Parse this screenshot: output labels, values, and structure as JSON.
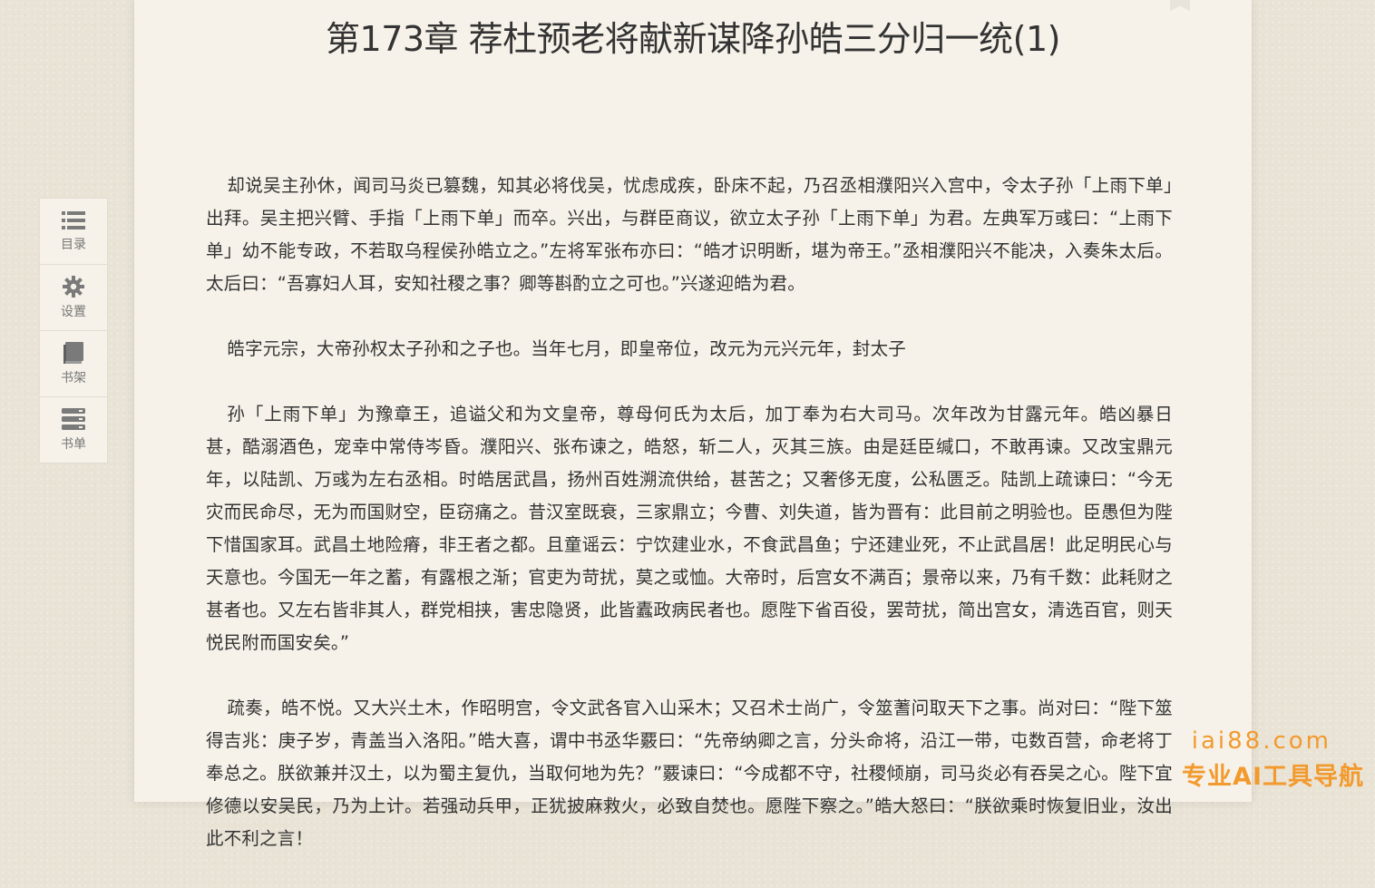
{
  "chapter": {
    "title": "第173章 荐杜预老将献新谋降孙皓三分归一统(1)",
    "paragraphs": [
      "却说吴主孙休，闻司马炎已篡魏，知其必将伐吴，忧虑成疾，卧床不起，乃召丞相濮阳兴入宫中，令太子孙「上雨下单」出拜。吴主把兴臂、手指「上雨下单」而卒。兴出，与群臣商议，欲立太子孙「上雨下单」为君。左典军万彧曰：“上雨下单」幼不能专政，不若取乌程侯孙皓立之。”左将军张布亦曰：“皓才识明断，堪为帝王。”丞相濮阳兴不能决，入奏朱太后。太后曰：“吾寡妇人耳，安知社稷之事？卿等斟酌立之可也。”兴遂迎皓为君。",
      "皓字元宗，大帝孙权太子孙和之子也。当年七月，即皇帝位，改元为元兴元年，封太子",
      "孙「上雨下单」为豫章王，追谥父和为文皇帝，尊母何氏为太后，加丁奉为右大司马。次年改为甘露元年。皓凶暴日甚，酷溺酒色，宠幸中常侍岑昏。濮阳兴、张布谏之，皓怒，斩二人，灭其三族。由是廷臣缄口，不敢再谏。又改宝鼎元年，以陆凯、万彧为左右丞相。时皓居武昌，扬州百姓溯流供给，甚苦之；又奢侈无度，公私匮乏。陆凯上疏谏曰：“今无灾而民命尽，无为而国财空，臣窃痛之。昔汉室既衰，三家鼎立；今曹、刘失道，皆为晋有：此目前之明验也。臣愚但为陛下惜国家耳。武昌土地险瘠，非王者之都。且童谣云：宁饮建业水，不食武昌鱼；宁还建业死，不止武昌居！此足明民心与天意也。今国无一年之蓄，有露根之渐；官吏为苛扰，莫之或恤。大帝时，后宫女不满百；景帝以来，乃有千数：此耗财之甚者也。又左右皆非其人，群党相挟，害忠隐贤，此皆蠹政病民者也。愿陛下省百役，罢苛扰，简出宫女，清选百官，则天悦民附而国安矣。”",
      "疏奏，皓不悦。又大兴土木，作昭明宫，令文武各官入山采木；又召术士尚广，令筮蓍问取天下之事。尚对曰：“陛下筮得吉兆：庚子岁，青盖当入洛阳。”皓大喜，谓中书丞华覈曰：“先帝纳卿之言，分头命将，沿江一带，屯数百营，命老将丁奉总之。朕欲兼并汉土，以为蜀主复仇，当取何地为先？”覈谏曰：“今成都不守，社稷倾崩，司马炎必有吞吴之心。陛下宜修德以安吴民，乃为上计。若强动兵甲，正犹披麻救火，必致自焚也。愿陛下察之。”皓大怒曰：“朕欲乘时恢复旧业，汝出此不利之言！"
    ]
  },
  "toolbar": {
    "items": [
      {
        "label": "目录",
        "icon": "list-icon"
      },
      {
        "label": "设置",
        "icon": "gear-icon"
      },
      {
        "label": "书架",
        "icon": "book-icon"
      },
      {
        "label": "书单",
        "icon": "booklist-icon"
      }
    ]
  },
  "watermark": {
    "url": "iai88.com",
    "text": "专业AI工具导航"
  },
  "colors": {
    "page_bg": "#f6f2e9",
    "outer_bg": "#e9e3d6",
    "text": "#333333",
    "watermark": "#f29a2e"
  }
}
